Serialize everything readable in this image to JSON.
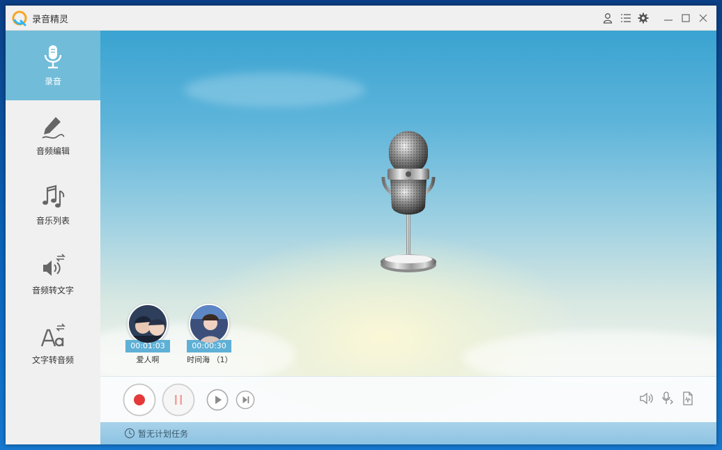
{
  "app": {
    "title": "录音精灵"
  },
  "titlebar_icons": [
    "user-icon",
    "list-icon",
    "gear-icon",
    "minimize-icon",
    "maximize-icon",
    "close-icon"
  ],
  "sidebar": {
    "items": [
      {
        "label": "录音",
        "icon": "microphone-icon",
        "active": true
      },
      {
        "label": "音频编辑",
        "icon": "pen-icon",
        "active": false
      },
      {
        "label": "音乐列表",
        "icon": "music-notes-icon",
        "active": false
      },
      {
        "label": "音频转文字",
        "icon": "speaker-convert-icon",
        "active": false
      },
      {
        "label": "文字转音频",
        "icon": "text-convert-icon",
        "active": false
      }
    ]
  },
  "recordings": [
    {
      "duration": "00:01:03",
      "name": "爱人啊"
    },
    {
      "duration": "00:00:30",
      "name": "时间海 （1）"
    }
  ],
  "controls": [
    "record-button",
    "pause-button",
    "play-button",
    "next-button"
  ],
  "right_controls": [
    "volume-icon",
    "microphone-input-icon",
    "audio-file-icon"
  ],
  "status": {
    "text": "暂无计划任务"
  },
  "colors": {
    "accent": "#71bcd9",
    "record": "#e53a3a",
    "pause": "#f2a1a1"
  }
}
